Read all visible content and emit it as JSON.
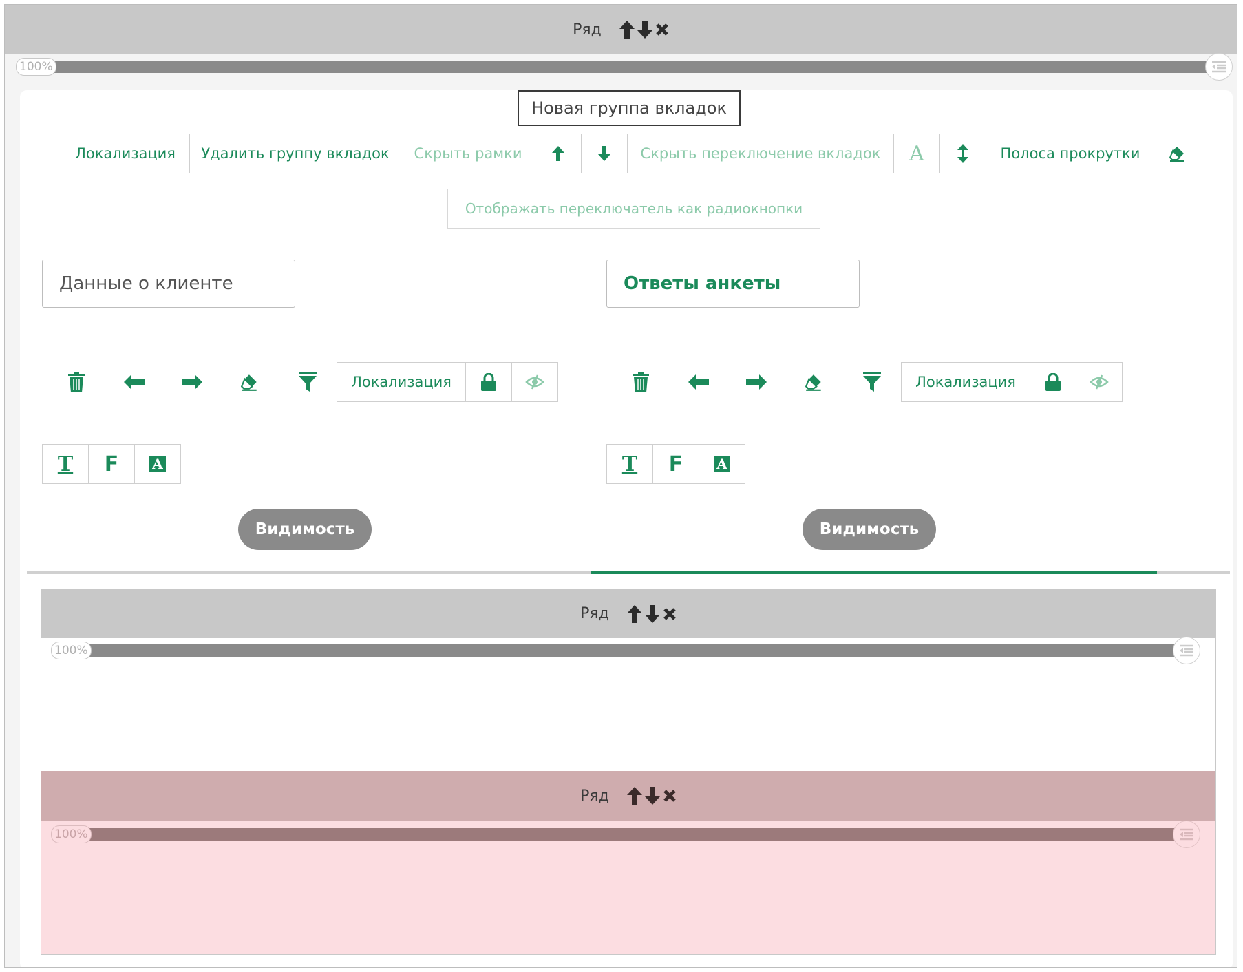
{
  "top_row": {
    "label": "Ряд",
    "slider_value": "100%"
  },
  "tab_group": {
    "title": "Новая группа вкладок",
    "toolbar": {
      "localization": "Локализация",
      "delete_group": "Удалить группу вкладок",
      "hide_borders": "Скрыть рамки",
      "hide_tab_switch": "Скрыть переключение вкладок",
      "font_glyph": "A",
      "scrollbar": "Полоса прокрутки"
    },
    "radio_option": "Отображать переключатель как радиокнопки"
  },
  "tabs": [
    {
      "name": "Данные о клиенте",
      "localization": "Локализация",
      "visibility": "Видимость",
      "fmt": [
        "T",
        "F",
        "A"
      ],
      "name_color": "#555555"
    },
    {
      "name": "Ответы анкеты",
      "localization": "Локализация",
      "visibility": "Видимость",
      "fmt": [
        "T",
        "F",
        "A"
      ],
      "name_color": "#1b8a5a"
    }
  ],
  "inner_rows": [
    {
      "label": "Ряд",
      "slider_value": "100%"
    },
    {
      "label": "Ряд",
      "slider_value": "100%"
    }
  ],
  "colors": {
    "accent": "#1b8a5a",
    "accent_muted": "#8ccaaa",
    "row_gray": "#c8c8c8",
    "row_pink": "#cfacae",
    "pink_bg": "#fcdde1"
  }
}
